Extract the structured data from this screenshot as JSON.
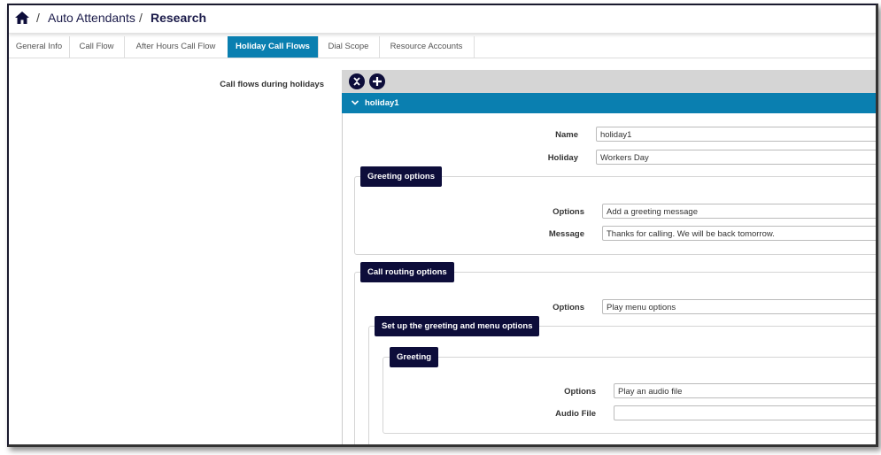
{
  "breadcrumb": {
    "home_icon": "home-icon",
    "parent": "Auto Attendants",
    "current": "Research",
    "separator": "/"
  },
  "tabs": [
    {
      "label": "General Info",
      "active": false
    },
    {
      "label": "Call Flow",
      "active": false
    },
    {
      "label": "After Hours Call Flow",
      "active": false
    },
    {
      "label": "Holiday Call Flows",
      "active": true
    },
    {
      "label": "Dial Scope",
      "active": false
    },
    {
      "label": "Resource Accounts",
      "active": false
    }
  ],
  "section_label": "Call flows during holidays",
  "toolbar": {
    "collapse_icon": "collapse-all-icon",
    "add_icon": "add-icon"
  },
  "holiday": {
    "title": "holiday1",
    "name_label": "Name",
    "name_value": "holiday1",
    "holiday_label": "Holiday",
    "holiday_value": "Workers Day",
    "greeting": {
      "legend": "Greeting options",
      "options_label": "Options",
      "options_value": "Add a greeting message",
      "message_label": "Message",
      "message_value": "Thanks for calling. We will be back tomorrow."
    },
    "routing": {
      "legend": "Call routing options",
      "options_label": "Options",
      "options_value": "Play menu options",
      "menu": {
        "legend": "Set up the greeting and menu options",
        "greeting": {
          "legend": "Greeting",
          "options_label": "Options",
          "options_value": "Play an audio file",
          "audio_label": "Audio File",
          "audio_value": ""
        }
      }
    }
  },
  "colors": {
    "accent": "#0a7fb0",
    "legend_bg": "#0d0d3a",
    "toolbar_bg": "#d5d5d5"
  }
}
